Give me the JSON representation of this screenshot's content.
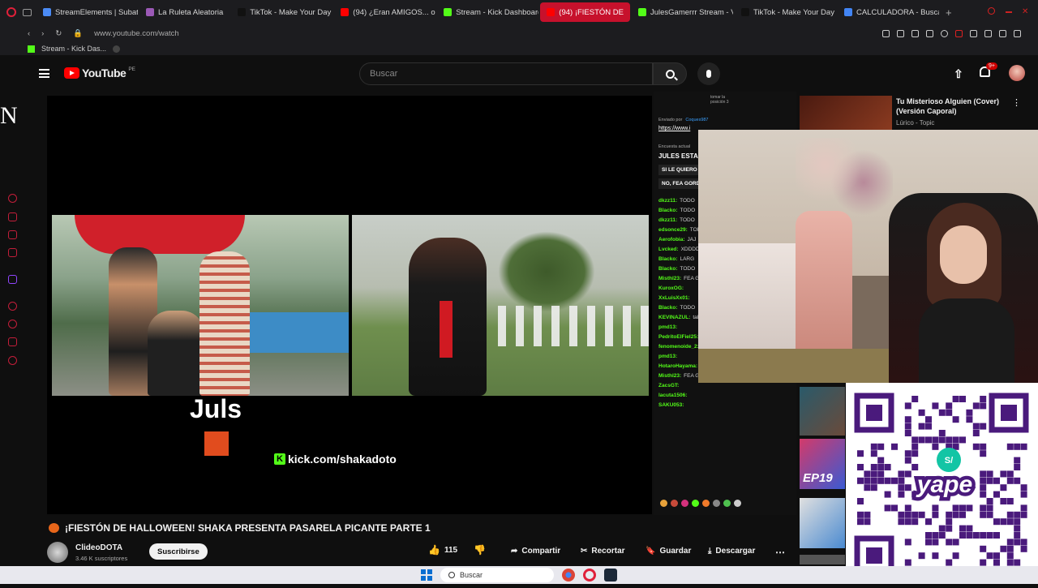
{
  "browser": {
    "tabs": [
      {
        "label": "StreamElements | Subath",
        "color": "#4b8bf5"
      },
      {
        "label": "La Ruleta Aleatoria",
        "color": "#9b59b6"
      },
      {
        "label": "TikTok - Make Your Day",
        "color": "#111111"
      },
      {
        "label": "(94) ¿Eran AMIGOS... o A",
        "color": "#ff0000"
      },
      {
        "label": "Stream - Kick Dashboard",
        "color": "#53fc18"
      },
      {
        "label": "(94) ¡FIESTÓN DE",
        "color": "#ff0000",
        "active": true
      },
      {
        "label": "JulesGamerrr Stream - V",
        "color": "#53fc18"
      },
      {
        "label": "TikTok - Make Your Day",
        "color": "#111111"
      },
      {
        "label": "CALCULADORA - Buscar",
        "color": "#4285f4"
      }
    ],
    "url": "www.youtube.com/watch",
    "bookmark": "Stream - Kick Das..."
  },
  "youtube": {
    "logo": "YouTube",
    "region": "PE",
    "search_placeholder": "Buscar",
    "notif_count": "9+",
    "edge_letter": "N"
  },
  "video": {
    "title": "¡FIESTÓN DE HALLOWEEN! SHAKA PRESENTA PASARELA PICANTE PARTE 1",
    "overlay_name": "Juls",
    "overlay_link": "kick.com/shakadoto",
    "channel": "ClideoDOTA",
    "subs": "3.46 K suscriptores",
    "subscribe": "Suscribirse",
    "likes": "115",
    "share": "Compartir",
    "clip": "Recortar",
    "save": "Guardar",
    "download": "Descargar"
  },
  "chat": {
    "pinned_pos": "tomar la posición 3",
    "sent_by": "Enviado por",
    "sent_user": "Coques987",
    "link": "https://www.i",
    "poll_label": "Encuesta actual",
    "poll_title": "JULES ESTA",
    "option1": "SI LE QUIERO",
    "option2": "NO, FEA GORD",
    "messages": [
      {
        "user": "dkzz11:",
        "text": "TODO"
      },
      {
        "user": "Blacko:",
        "text": "TODO"
      },
      {
        "user": "dkzz11:",
        "text": "TODO"
      },
      {
        "user": "edsonce29:",
        "text": "TODO"
      },
      {
        "user": "Aerofobia:",
        "text": "JAJ"
      },
      {
        "user": "Lvcked:",
        "text": "XDDDDDDDDD"
      },
      {
        "user": "Blacko:",
        "text": "LARG"
      },
      {
        "user": "Blacko:",
        "text": "TODO"
      },
      {
        "user": "Misthl23:",
        "text": "FEA G"
      },
      {
        "user": "KuroxOG:",
        "text": ""
      },
      {
        "user": "XxLuisXx01:",
        "text": ""
      },
      {
        "user": "Blacko:",
        "text": "TODO"
      },
      {
        "user": "KEVINAZUL:",
        "text": "tal"
      },
      {
        "user": "pmd13:",
        "text": ""
      },
      {
        "user": "PedritoElFiel25:",
        "text": ""
      },
      {
        "user": "fenomenoide_2:",
        "text": ""
      },
      {
        "user": "pmd13:",
        "text": ""
      },
      {
        "user": "HotaroHayama:",
        "text": ""
      },
      {
        "user": "Misthl23:",
        "text": "FEA GORDA"
      },
      {
        "user": "ZacsGT:",
        "text": ""
      },
      {
        "user": "lacuta1506:",
        "text": ""
      },
      {
        "user": "SAKU053:",
        "text": ""
      }
    ]
  },
  "recommended": {
    "title": "Tu Misterioso Alguien (Cover) (Versión Caporal)",
    "meta": "Lúrico - Topic",
    "ep": "EP19"
  },
  "qr": {
    "brand": "yape",
    "symbol": "S/"
  },
  "taskbar": {
    "search": "Buscar"
  }
}
